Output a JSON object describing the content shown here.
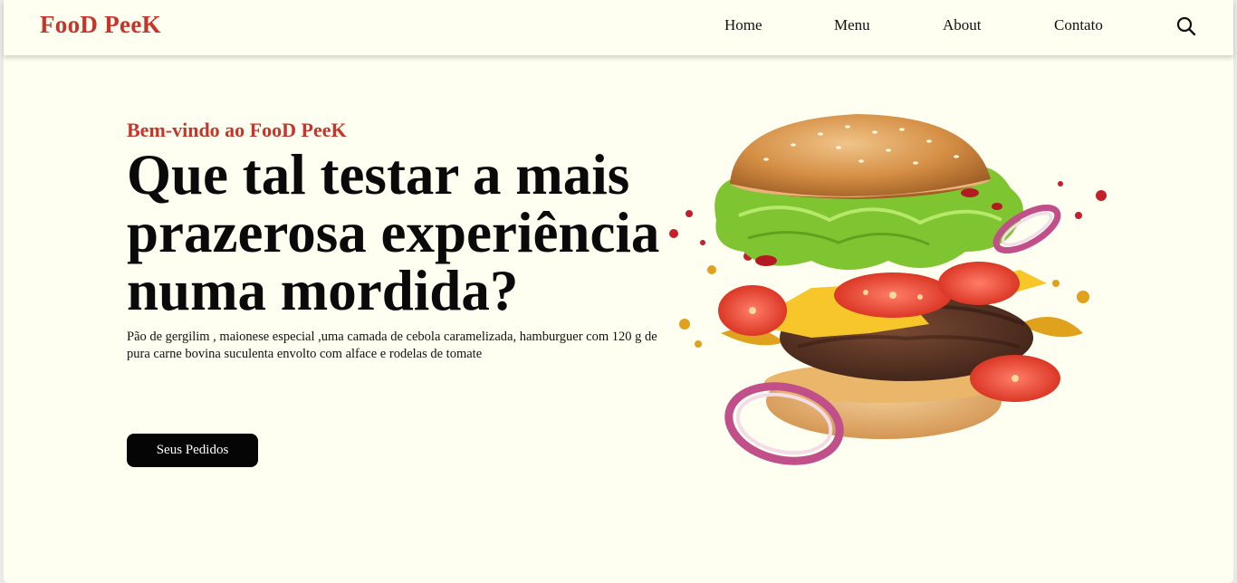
{
  "header": {
    "logo": {
      "part1": "Foo",
      "part2": "D",
      "part3": " Pee",
      "part4": "K"
    },
    "nav": [
      {
        "label": "Home"
      },
      {
        "label": "Menu"
      },
      {
        "label": "About"
      },
      {
        "label": "Contato"
      }
    ],
    "search_icon": "search-icon"
  },
  "hero": {
    "welcome": "Bem-vindo ao FooD PeeK",
    "headline": "Que tal testar a mais prazerosa experiência numa mordida?",
    "description": "Pão de gergilim , maionese especial ,uma camada de cebola caramelizada, hamburguer com 120 g de pura carne bovina suculenta envolto com alface e rodelas de tomate",
    "cta_label": "Seus Pedidos",
    "image": "flying-burger-image"
  },
  "colors": {
    "accent": "#c8342a",
    "background": "#fefff0",
    "button": "#050505"
  }
}
